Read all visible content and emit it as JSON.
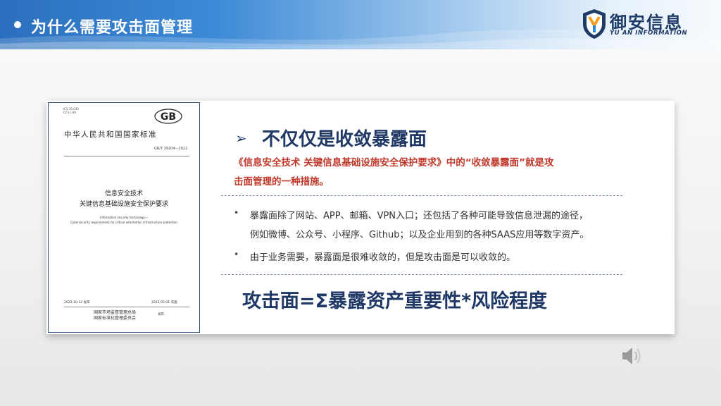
{
  "header": {
    "title": "为什么需要攻击面管理"
  },
  "logo": {
    "name_cn": "御安信息",
    "name_en": "YU AN INFORMATION"
  },
  "document": {
    "ics": [
      "ICS 35.030",
      "CCS L 80"
    ],
    "gb_mark": "GB",
    "national_standard": "中华人民共和国国家标准",
    "code": "GB/T 39204—2022",
    "title_line1": "信息安全技术",
    "title_line2": "关键信息基础设施安全保护要求",
    "english_line1": "Information security technology—",
    "english_line2": "Cybersecurity requirements for critical information infrastructure protection",
    "issue_date": "2022-10-12 发布",
    "implement_date": "2023-05-01 实施",
    "publisher_line1": "国家市场监督管理总局",
    "publisher_line2": "国家标准化管理委员会",
    "publisher_suffix": "发布"
  },
  "content": {
    "heading_arrow": "➢",
    "heading": "不仅仅是收敛暴露面",
    "red_line1": "《信息安全技术 关键信息基础设施安全保护要求》中的“收敛暴露面”就是攻",
    "red_line2": "击面管理的一种措施。",
    "bullet_marker": "•",
    "bullet1_line1": "暴露面除了网站、APP、邮箱、VPN入口；还包括了各种可能导致信息泄漏的途径，",
    "bullet1_line2": "例如微博、公众号、小程序、Github；以及企业用到的各种SAAS应用等数字资产。",
    "bullet2": "由于业务需要，暴露面是很难收敛的，但是攻击面是可以收敛的。",
    "formula": "攻击面=Σ暴露资产重要性*风险程度"
  }
}
